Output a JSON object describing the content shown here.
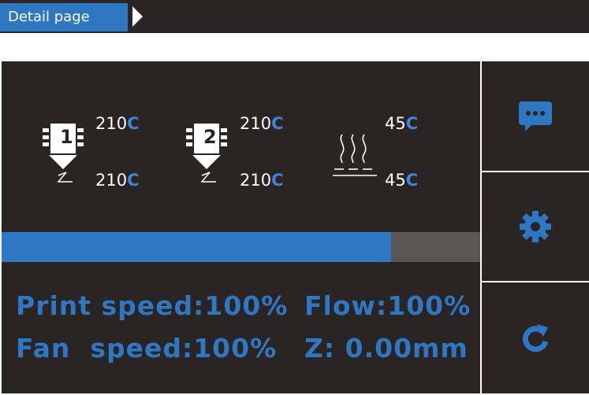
{
  "header": {
    "title": "Detail page",
    "arrow_icon": "chevron-right-icon"
  },
  "temperatures": {
    "extruder1": {
      "label": "1",
      "current": "210",
      "target": "210",
      "unit": "C"
    },
    "extruder2": {
      "label": "2",
      "current": "210",
      "target": "210",
      "unit": "C"
    },
    "bed": {
      "current": "45",
      "target": "45",
      "unit": "C"
    }
  },
  "progress": {
    "fraction": 0.814
  },
  "stats": {
    "print_speed": "Print speed:100%",
    "flow": "Flow:100%",
    "fan_speed": "Fan  speed:100%",
    "z": "Z: 0.00mm"
  },
  "sidebar": {
    "buttons": [
      {
        "icon": "message-icon"
      },
      {
        "icon": "gear-icon"
      },
      {
        "icon": "refresh-icon"
      }
    ]
  },
  "colors": {
    "background": "#2b2424",
    "accent": "#2e77c2",
    "progress_track": "#5a5656",
    "text": "#ffffff"
  }
}
